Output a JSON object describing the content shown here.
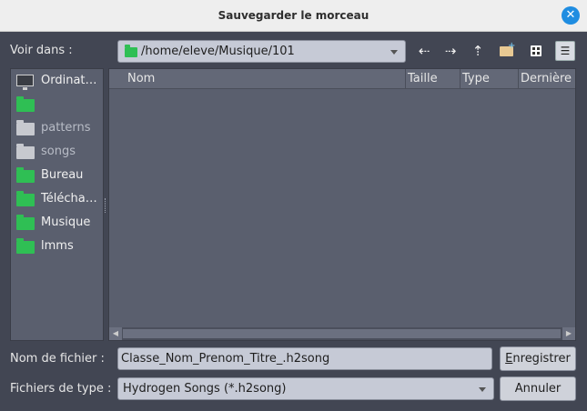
{
  "window": {
    "title": "Sauvegarder le morceau"
  },
  "lookin": {
    "label": "Voir dans :",
    "path": "/home/eleve/Musique/101"
  },
  "toolbar": {
    "back": "back-icon",
    "forward": "forward-icon",
    "up": "up-icon",
    "new_folder": "new-folder-icon",
    "detail_view": "detail-view-icon",
    "list_view": "list-view-icon"
  },
  "sidebar": {
    "items": [
      {
        "label": "Ordinat…",
        "icon": "computer-icon"
      },
      {
        "label": "",
        "icon": "folder-icon"
      },
      {
        "label": "patterns",
        "icon": "folder-icon"
      },
      {
        "label": "songs",
        "icon": "folder-icon"
      },
      {
        "label": "Bureau",
        "icon": "folder-icon"
      },
      {
        "label": "Télécha…",
        "icon": "folder-icon"
      },
      {
        "label": "Musique",
        "icon": "folder-icon"
      },
      {
        "label": "lmms",
        "icon": "folder-icon"
      }
    ]
  },
  "filelist": {
    "columns": [
      "Nom",
      "Taille",
      "Type",
      "Dernière"
    ]
  },
  "filename": {
    "label": "Nom de fichier :",
    "value": "Classe_Nom_Prenom_Titre_.h2song"
  },
  "filetype": {
    "label": "Fichiers de type :",
    "value": "Hydrogen Songs (*.h2song)"
  },
  "buttons": {
    "save_u": "E",
    "save_rest": "nregistrer",
    "cancel": "Annuler"
  },
  "colors": {
    "accent": "#1f8de1",
    "folder": "#2fbf54",
    "folder_dim": "#c7c9cf"
  }
}
